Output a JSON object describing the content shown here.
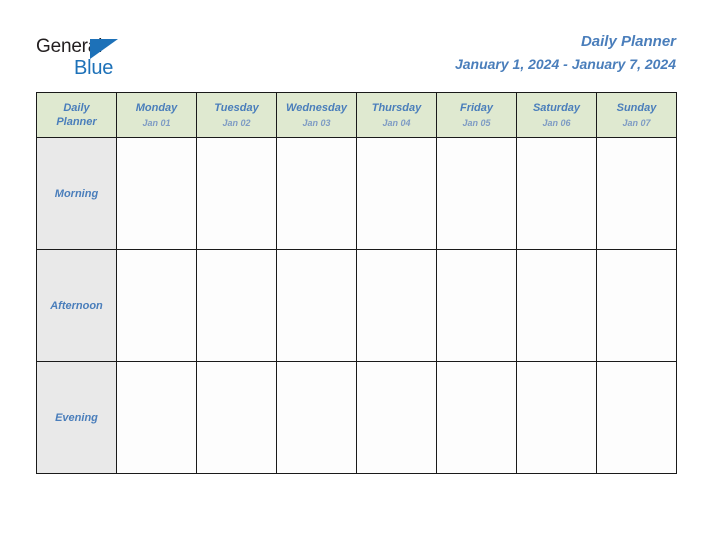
{
  "brand": {
    "line1": "General",
    "line2": "Blue",
    "triangle_icon": "triangle-right-icon",
    "colors": {
      "text_dark": "#231f20",
      "blue": "#1d71b8"
    }
  },
  "title": {
    "heading": "Daily Planner",
    "date_range": "January 1, 2024 - January 7, 2024"
  },
  "table": {
    "corner": {
      "line1": "Daily",
      "line2": "Planner"
    },
    "columns": [
      {
        "day": "Monday",
        "date": "Jan 01"
      },
      {
        "day": "Tuesday",
        "date": "Jan 02"
      },
      {
        "day": "Wednesday",
        "date": "Jan 03"
      },
      {
        "day": "Thursday",
        "date": "Jan 04"
      },
      {
        "day": "Friday",
        "date": "Jan 05"
      },
      {
        "day": "Saturday",
        "date": "Jan 06"
      },
      {
        "day": "Sunday",
        "date": "Jan 07"
      }
    ],
    "rows": [
      {
        "label": "Morning",
        "cells": [
          "",
          "",
          "",
          "",
          "",
          "",
          ""
        ]
      },
      {
        "label": "Afternoon",
        "cells": [
          "",
          "",
          "",
          "",
          "",
          "",
          ""
        ]
      },
      {
        "label": "Evening",
        "cells": [
          "",
          "",
          "",
          "",
          "",
          "",
          ""
        ]
      }
    ]
  },
  "colors": {
    "header_bg": "#dfe9d0",
    "row_label_bg": "#e9e9e9",
    "accent_blue": "#4a7ebb",
    "subtext_blue": "#7e9bc4",
    "border": "#1a1a1a",
    "cell_bg": "#fdfdfd"
  }
}
